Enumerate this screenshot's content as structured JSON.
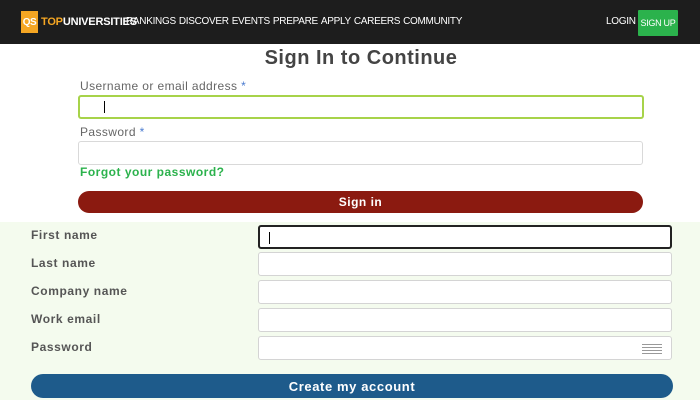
{
  "navbar": {
    "logo_mark": "QS",
    "logo_text_a": "TOP",
    "logo_text_b": "UNIVERSITIES",
    "items": [
      "RANKINGS",
      "DISCOVER",
      "EVENTS",
      "PREPARE",
      "APPLY",
      "CAREERS",
      "COMMUNITY"
    ],
    "login_label": "LOGIN",
    "signup_label": "SIGN UP",
    "colors": {
      "background": "#1d1d1d",
      "accent": "#f5a623",
      "signup": "#2bb24c"
    }
  },
  "signin": {
    "title": "Sign In to Continue",
    "username_label": "Username or email address",
    "password_label": "Password",
    "required_mark": "*",
    "username_value": "",
    "password_value": "",
    "forgot_label": "Forgot your password?",
    "button_label": "Sign in",
    "colors": {
      "button": "#8b1a10",
      "link": "#2bb24c",
      "focus": "#a7d34a"
    }
  },
  "create_account": {
    "fields": [
      {
        "label": "First name",
        "value": ""
      },
      {
        "label": "Last name",
        "value": ""
      },
      {
        "label": "Company name",
        "value": ""
      },
      {
        "label": "Work email",
        "value": ""
      },
      {
        "label": "Password",
        "value": ""
      }
    ],
    "button_label": "Create my account",
    "password_icon": "menu-lines-icon",
    "colors": {
      "background": "#f4fbee",
      "button": "#1e5b8b"
    }
  }
}
